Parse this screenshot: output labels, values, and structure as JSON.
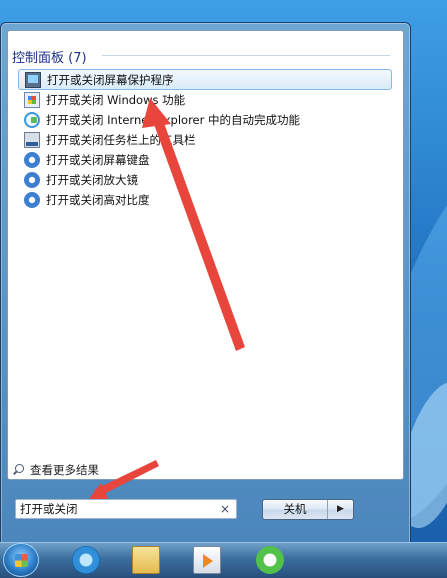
{
  "start_menu": {
    "section_title": "控制面板 (7)",
    "items": [
      {
        "label": "打开或关闭屏幕保护程序",
        "icon": "screensaver-monitor-icon",
        "selected": true
      },
      {
        "label": "打开或关闭 Windows 功能",
        "icon": "windows-features-icon",
        "selected": false
      },
      {
        "label": "打开或关闭 Internet Explorer 中的自动完成功能",
        "icon": "internet-explorer-icon",
        "selected": false
      },
      {
        "label": "打开或关闭任务栏上的工具栏",
        "icon": "taskbar-icon",
        "selected": false
      },
      {
        "label": "打开或关闭屏幕键盘",
        "icon": "ease-of-access-icon",
        "selected": false
      },
      {
        "label": "打开或关闭放大镜",
        "icon": "ease-of-access-icon",
        "selected": false
      },
      {
        "label": "打开或关闭高对比度",
        "icon": "ease-of-access-icon",
        "selected": false
      }
    ],
    "more_results": "查看更多结果",
    "search_value": "打开或关闭",
    "clear_symbol": "×",
    "shutdown_label": "关机",
    "shutdown_arrow": "▶"
  },
  "taskbar": {
    "icons": [
      "start-orb-icon",
      "internet-explorer-icon",
      "windows-explorer-icon",
      "media-player-icon",
      "360-browser-icon"
    ]
  },
  "colors": {
    "annotation_arrow": "#e8463d",
    "section_title": "#1e3287",
    "selection_border": "#86b8e6"
  }
}
